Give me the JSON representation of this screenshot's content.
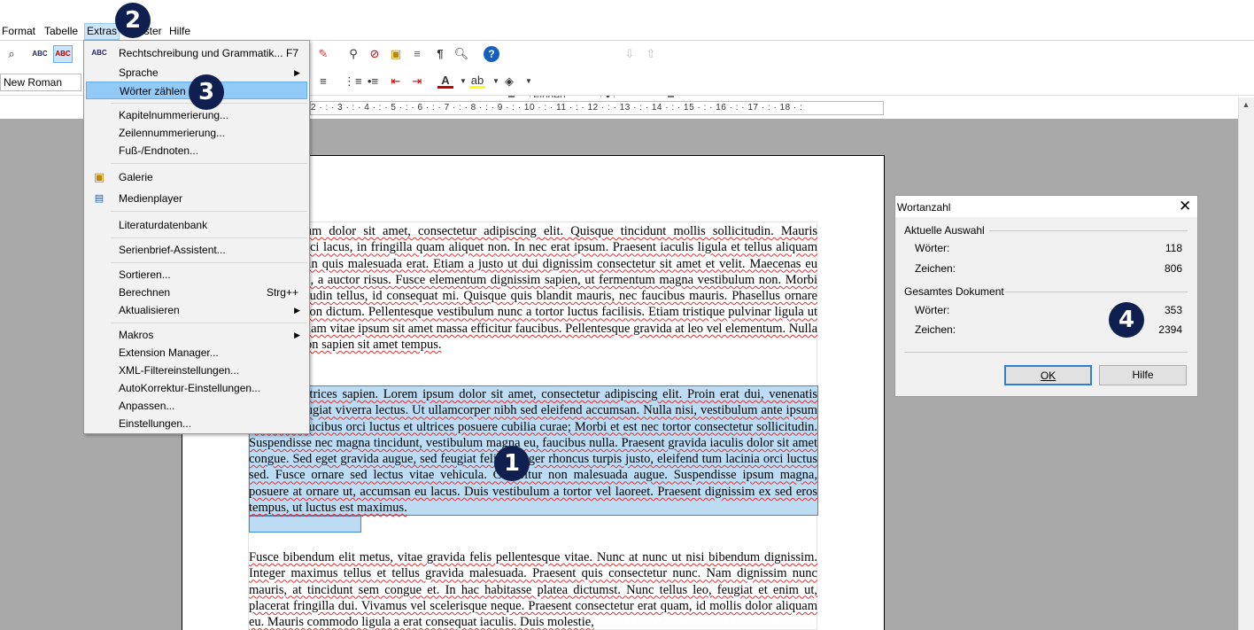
{
  "menubar": {
    "items": [
      "Format",
      "Tabelle",
      "Extras",
      "Fenster",
      "Hilfe"
    ]
  },
  "toolbar": {
    "font_name": "New Roman",
    "find_placeholder": "Finden"
  },
  "ruler": {
    "ticks": "2 · : · 3 · : · 4 · : · 5 · : · 6 · : · 7 · : · 8 · : · 9 · : · 10 · : · 11 · : · 12 · : · 13 · : · 14 · : · 15 · : · 16 · : · 17 · : · 18 · :"
  },
  "extras_menu": {
    "items": [
      {
        "label": "Rechtschreibung und Grammatik...",
        "shortcut": "F7",
        "icon": "spellcheck-icon"
      },
      {
        "label": "Sprache",
        "submenu": true
      },
      {
        "label": "Wörter zählen",
        "highlighted": true
      },
      {
        "label": "Kapitelnummerierung..."
      },
      {
        "label": "Zeilennummerierung..."
      },
      {
        "label": "Fuß-/Endnoten..."
      },
      {
        "label": "Galerie",
        "icon": "gallery-icon"
      },
      {
        "label": "Medienplayer",
        "icon": "media-player-icon"
      },
      {
        "label": "Literaturdatenbank"
      },
      {
        "label": "Serienbrief-Assistent..."
      },
      {
        "label": "Sortieren..."
      },
      {
        "label": "Berechnen",
        "shortcut": "Strg++"
      },
      {
        "label": "Aktualisieren",
        "submenu": true
      },
      {
        "label": "Makros",
        "submenu": true
      },
      {
        "label": "Extension Manager..."
      },
      {
        "label": "XML-Filtereinstellungen..."
      },
      {
        "label": "AutoKorrektur-Einstellungen..."
      },
      {
        "label": "Anpassen..."
      },
      {
        "label": "Einstellungen..."
      }
    ]
  },
  "document": {
    "para1": "Lorem ipsum dolor sit amet, consectetur adipiscing elit. Quisque tincidunt mollis sollicitudin. Mauris convallis orci lacus, in fringilla quam aliquet non. In nec erat ipsum. Praesent iaculis ligula et tellus aliquam iaculis. Proin quis malesuada erat. Etiam a justo ut dui dignissim consectetur sit amet et velit. Maecenas eu efficitur dui, a auctor risus. Fusce elementum dignissim sapien, ut fermentum magna vestibulum non. Morbi eget sollicitudin tellus, id consequat mi. Quisque quis blandit mauris, nec faucibus mauris. Phasellus ornare sed lectus non dictum. Pellentesque vestibulum nunc a tortor luctus facilisis. Etiam tristique pulvinar ligula ut ornare. Nullam vitae ipsum sit amet massa efficitur faucibus. Pellentesque gravida at leo vel elementum. Nulla maximus non sapien sit amet tempus.",
    "para2": "Vivamus ultrices sapien. Lorem ipsum dolor sit amet, consectetur adipiscing elit. Proin erat dui, venenatis nulla ac, feugiat viverra lectus. Ut ullamcorper nibh sed eleifend accumsan. Nulla nisi, vestibulum ante ipsum primis in faucibus orci luctus et ultrices posuere cubilia curae; Morbi et est nec tortor consectetur sollicitudin. Suspendisse nec magna tincidunt, vestibulum magna eu, faucibus nulla. Praesent gravida iaculis dolor sit amet congue. Sed eget gravida augue, sed feugiat felis. Integer rhoncus turpis justo, eleifend tum lacinia orci luctus sed. Fusce ornare sed lectus vitae vehicula. Curabitur non malesuada augue. Suspendisse ipsum magna, posuere at ornare ut, accumsan eu lacus. Duis vestibulum a tortor vel laoreet. Praesent dignissim ex sed eros tempus, ut luctus est maximus.",
    "para3": "Fusce bibendum elit metus, vitae gravida felis pellentesque vitae. Nunc at nunc ut nisi bibendum dignissim. Integer maximus tellus et tellus gravida malesuada. Praesent quis consectetur nunc. Nam dignissim nunc mauris, at tincidunt sem congue et. In hac habitasse platea dictumst. Nunc tellus leo, feugiat et enim ut, placerat fringilla dui. Vivamus vel scelerisque neque. Praesent consectetur erat quam, id mollis dolor aliquam eu. Mauris commodo ligula a erat consequat iaculis. Duis molestie,"
  },
  "dialog": {
    "title": "Wortanzahl",
    "selection_heading": "Aktuelle Auswahl",
    "selection_words_label": "Wörter:",
    "selection_words": "118",
    "selection_chars_label": "Zeichen:",
    "selection_chars": "806",
    "document_heading": "Gesamtes Dokument",
    "document_words_label": "Wörter:",
    "document_words": "353",
    "document_chars_label": "Zeichen:",
    "document_chars": "2394",
    "ok_label": "OK",
    "help_label": "Hilfe"
  },
  "badges": [
    "1",
    "2",
    "3",
    "4"
  ],
  "colors": {
    "badge": "#0f1f4f",
    "selection": "#bcdcf4",
    "menu_highlight": "#91c9f7",
    "spell_underline": "#e03030"
  }
}
